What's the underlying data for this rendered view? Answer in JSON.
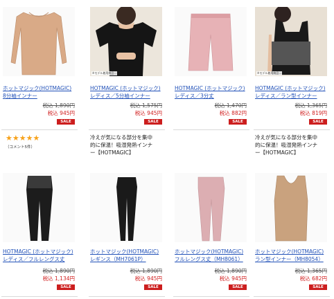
{
  "products": [
    {
      "name_line1": "ホットマジック(HOTMAGIC)",
      "name_line2": "8分袖インナー",
      "old_price": "税込 1,890円",
      "price": "税込 945円",
      "badge": "SALE",
      "thumb_caption": "",
      "icon": "beige-long-sleeve-top"
    },
    {
      "name_line1": "HOTMAGIC (ホットマジック)",
      "name_line2": "レディス／5分袖インナー",
      "old_price": "税込 1,575円",
      "price": "税込 945円",
      "badge": "SALE",
      "thumb_caption": "※モデル着用商品…",
      "icon": "black-half-sleeve-top"
    },
    {
      "name_line1": "HOTMAGIC (ホットマジック)",
      "name_line2": "レディス／3分丈",
      "old_price": "税込 1,470円",
      "price": "税込 882円",
      "badge": "SALE",
      "thumb_caption": "",
      "icon": "pink-shorts"
    },
    {
      "name_line1": "HOTMAGIC (ホットマジック)",
      "name_line2": "レディス／ラン型インナー",
      "old_price": "税込 1,365円",
      "price": "税込 819円",
      "badge": "SALE",
      "thumb_caption": "※モデル着用商品…",
      "icon": "black-tank-top"
    },
    {
      "name_line1": "HOTMAGIC (ホットマジック)",
      "name_line2": "レディス／フルレングス丈",
      "old_price": "税込 1,890円",
      "price": "税込 1,134円",
      "badge": "SALE",
      "thumb_caption": "",
      "icon": "black-full-leggings"
    },
    {
      "name_line1": "ホットマジック(HOTMAGIC)",
      "name_line2": "レギンス（MH7061P）",
      "old_price": "税込 1,890円",
      "price": "税込 945円",
      "badge": "SALE",
      "thumb_caption": "",
      "icon": "black-leggings"
    },
    {
      "name_line1": "ホットマジック(HOTMAGIC)",
      "name_line2": "フルレングス丈（MH8061）",
      "old_price": "税込 1,890円",
      "price": "税込 945円",
      "badge": "SALE",
      "thumb_caption": "",
      "icon": "pink-full-leggings"
    },
    {
      "name_line1": "ホットマジック(HOTMAGIC)",
      "name_line2": "ラン型インナー（MH8054）",
      "old_price": "税込 1,365円",
      "price": "税込 682円",
      "badge": "SALE",
      "thumb_caption": "",
      "icon": "beige-tank-top"
    }
  ],
  "reviews": {
    "stars": "★★★★★",
    "count_text": "（コメント5件）"
  },
  "descriptions": [
    {
      "line1": "冷えが気になる部分を集中",
      "line2": "的に保温！吸湿発熱インナ",
      "line3": "ー【HOTMAGIC】"
    },
    {
      "line1": "冷えが気になる部分を集中",
      "line2": "的に保温！吸湿発熱インナ",
      "line3": "ー【HOTMAGIC】"
    }
  ],
  "colors": {
    "link": "#2050b8",
    "price_red": "#d01c1c",
    "sale_badge": "#cc1e1e",
    "star": "#f7a21b"
  }
}
